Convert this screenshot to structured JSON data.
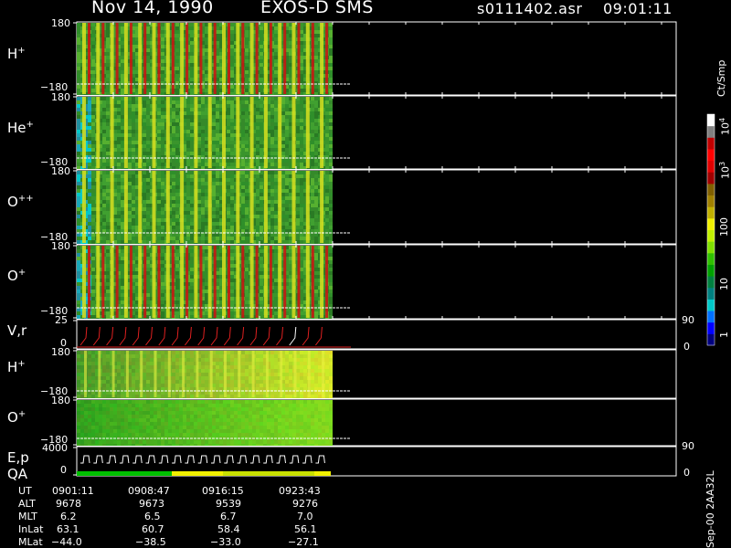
{
  "header": {
    "date": "Nov 14, 1990",
    "instrument": "EXOS-D SMS",
    "file": "s0111402.asr",
    "time": "09:01:11"
  },
  "colorbar": {
    "unit": "Ct/Smp",
    "ticks": [
      "1",
      "10",
      "100",
      "10",
      "10"
    ],
    "tick_exponents": [
      "",
      "",
      "",
      "3",
      "4"
    ],
    "colors": [
      "#00007f",
      "#0000ff",
      "#0070ff",
      "#00c8c8",
      "#008080",
      "#008040",
      "#00a000",
      "#30c000",
      "#80e000",
      "#c0f000",
      "#f0f000",
      "#c0b000",
      "#a08000",
      "#806000",
      "#a00000",
      "#e00000",
      "#ff0000",
      "#c00000",
      "#808080",
      "#ffffff"
    ],
    "scale": "log"
  },
  "panels": [
    {
      "label": "H",
      "charge": "+",
      "ymax": "180",
      "ymin": "−180",
      "kind": "spec",
      "base": "#3a9a2a"
    },
    {
      "label": "He",
      "charge": "+",
      "ymax": "180",
      "ymin": "−180",
      "kind": "spec",
      "base": "#2f8a2a"
    },
    {
      "label": "O",
      "charge": "++",
      "ymax": "180",
      "ymin": "−180",
      "kind": "spec",
      "base": "#3a8f2a"
    },
    {
      "label": "O",
      "charge": "+",
      "ymax": "180",
      "ymin": "−180",
      "kind": "spec",
      "base": "#3a8f2a"
    },
    {
      "label": "V,r",
      "charge": "",
      "ymax": "25",
      "ymin": "0",
      "kind": "line",
      "right_top": "90",
      "right_bottom": "0"
    },
    {
      "label": "H",
      "charge": "+",
      "ymax": "180",
      "ymin": "−180",
      "kind": "spec2",
      "base": "#5cb82a"
    },
    {
      "label": "O",
      "charge": "+",
      "ymax": "180",
      "ymin": "−180",
      "kind": "spec3",
      "base": "#4ea82a"
    },
    {
      "label": "E,p",
      "label2": "QA",
      "charge": "",
      "ymax": "4000",
      "ymin": "0",
      "kind": "line2",
      "right_top": "90",
      "right_bottom": "0"
    }
  ],
  "footer": {
    "row_labels": [
      "UT",
      "ALT",
      "MLT",
      "InLat",
      "MLat"
    ],
    "columns": [
      [
        "0901:11",
        "9678",
        "6.2",
        "63.1",
        "−44.0"
      ],
      [
        "0908:47",
        "9673",
        "6.5",
        "60.7",
        "−38.5"
      ],
      [
        "0916:15",
        "9539",
        "6.7",
        "58.4",
        "−33.0"
      ],
      [
        "0923:43",
        "9276",
        "7.0",
        "56.1",
        "−27.1"
      ]
    ],
    "side_note": "Sep-00 2AA32L"
  },
  "qa_bar_colors": [
    "#00c000",
    "#f0f000"
  ]
}
